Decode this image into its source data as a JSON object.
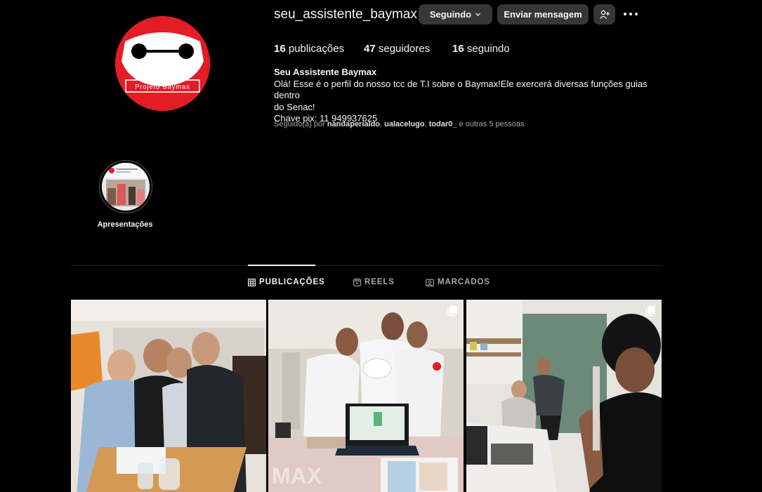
{
  "profile": {
    "username": "seu_assistente_baymax",
    "avatar_text": "Projeto Baymax",
    "display_name": "Seu Assistente Baymax",
    "bio_lines": [
      "Olá! Esse é o perfil do nosso tcc de T.I sobre o Baymax!Ele exercerá diversas funções guias dentro",
      "do Senac!",
      "Chave pix: 11 949937625"
    ]
  },
  "actions": {
    "follow_label": "Seguindo",
    "message_label": "Enviar mensagem",
    "suggest_icon": "add-person-icon",
    "more_icon": "more-options-icon"
  },
  "stats": {
    "posts_count": "16",
    "posts_label": "publicações",
    "followers_count": "47",
    "followers_label": "seguidores",
    "following_count": "16",
    "following_label": "seguindo"
  },
  "followed_by": {
    "prefix": "Seguido(a) por ",
    "users": [
      "nandaperialdo",
      "ualacelugo",
      "todar0_"
    ],
    "suffix": " e outras 5 pessoas"
  },
  "highlight": {
    "label": "Apresentações"
  },
  "tabs": [
    {
      "label": "PUBLICAÇÕES",
      "icon": "grid-icon",
      "active": true
    },
    {
      "label": "REELS",
      "icon": "reels-icon",
      "active": false
    },
    {
      "label": "MARCADOS",
      "icon": "tagged-icon",
      "active": false
    }
  ],
  "posts": [
    {
      "description": "group photo with older man",
      "multi": false
    },
    {
      "description": "students with Baymax robot and laptop",
      "multi": true
    },
    {
      "description": "selfie in room with electronics",
      "multi": true
    }
  ],
  "colors": {
    "background": "#000000",
    "button": "#363636",
    "text": "#f5f5f5",
    "muted": "#a8a8a8",
    "brand_red": "#e31c25"
  }
}
